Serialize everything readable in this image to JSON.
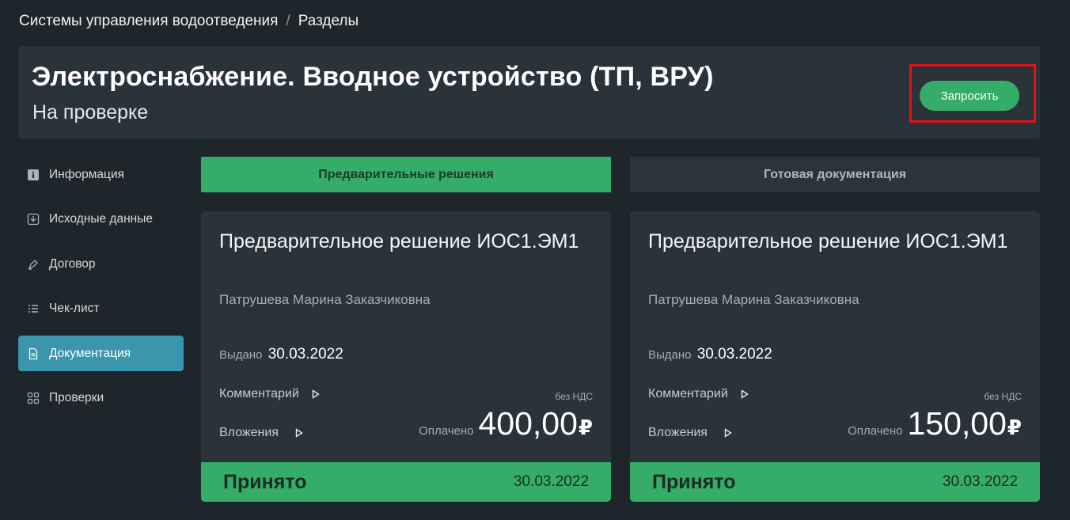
{
  "breadcrumb": {
    "items": [
      "Системы управления водоотведения",
      "Разделы"
    ],
    "separator": "/"
  },
  "header": {
    "title": "Электроснабжение. Вводное устройство (ТП, ВРУ)",
    "status": "На проверке",
    "request_label": "Запросить"
  },
  "sidebar": {
    "items": [
      {
        "label": "Информация",
        "icon": "info-icon"
      },
      {
        "label": "Исходные данные",
        "icon": "download-icon"
      },
      {
        "label": "Договор",
        "icon": "pen-icon"
      },
      {
        "label": "Чек-лист",
        "icon": "checklist-icon"
      },
      {
        "label": "Документация",
        "icon": "document-icon",
        "active": true
      },
      {
        "label": "Проверки",
        "icon": "checks-grid-icon"
      }
    ]
  },
  "tabs": [
    {
      "label": "Предварительные решения",
      "active": true
    },
    {
      "label": "Готовая документация",
      "active": false
    }
  ],
  "cards": [
    {
      "title": "Предварительное решение ИОС1.ЭМ1",
      "person": "Патрушева Марина Заказчиковна",
      "issued_label": "Выдано",
      "issued_date": "30.03.2022",
      "comment_label": "Комментарий",
      "attachments_label": "Вложения",
      "vat_note": "без НДС",
      "paid_label": "Оплачено",
      "amount": "400,00",
      "currency": "₽",
      "status": "Принято",
      "status_date": "30.03.2022"
    },
    {
      "title": "Предварительное решение ИОС1.ЭМ1",
      "person": "Патрушева Марина Заказчиковна",
      "issued_label": "Выдано",
      "issued_date": "30.03.2022",
      "comment_label": "Комментарий",
      "attachments_label": "Вложения",
      "vat_note": "без НДС",
      "paid_label": "Оплачено",
      "amount": "150,00",
      "currency": "₽",
      "status": "Принято",
      "status_date": "30.03.2022"
    }
  ],
  "colors": {
    "background": "#1e252b",
    "panel": "#2a323a",
    "accent_green": "#35ad68",
    "active_sidebar": "#3a95ad",
    "highlight_red": "#e01414"
  }
}
